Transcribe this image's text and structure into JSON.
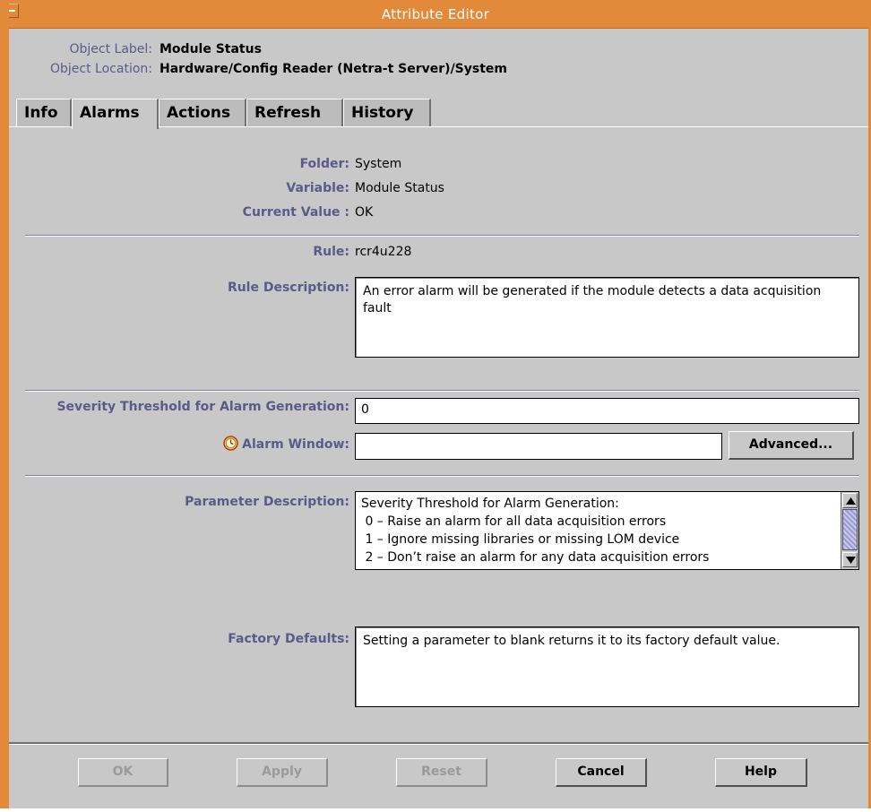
{
  "window": {
    "title": "Attribute Editor",
    "frame_color": "#e2893a"
  },
  "object": {
    "label_key": "Object Label:",
    "label_value": "Module Status",
    "location_key": "Object Location:",
    "location_value": "Hardware/Config Reader (Netra-t Server)/System"
  },
  "tabs": [
    {
      "label": "Info",
      "active": false
    },
    {
      "label": "Alarms",
      "active": true
    },
    {
      "label": "Actions",
      "active": false
    },
    {
      "label": "Refresh",
      "active": false
    },
    {
      "label": "History",
      "active": false
    }
  ],
  "alarms": {
    "folder_label": "Folder:",
    "folder_value": "System",
    "variable_label": "Variable:",
    "variable_value": "Module Status",
    "current_value_label": "Current Value :",
    "current_value": "OK",
    "rule_label": "Rule:",
    "rule_value": "rcr4u228",
    "rule_description_label": "Rule Description:",
    "rule_description": "An error alarm will be generated if the module detects a data acquisition fault",
    "severity_label": "Severity Threshold for Alarm Generation:",
    "severity_value": "0",
    "alarm_window_label": "Alarm Window:",
    "alarm_window_value": "",
    "alarm_window_icon": "clock-icon",
    "advanced_button": "Advanced...",
    "parameter_description_label": "Parameter Description:",
    "parameter_lines": [
      "Severity Threshold for Alarm Generation:",
      " 0 – Raise an alarm for all data acquisition errors",
      " 1 – Ignore missing libraries or missing LOM device",
      " 2 – Don’t raise an alarm for any data acquisition errors"
    ],
    "factory_defaults_label": "Factory Defaults:",
    "factory_defaults": "Setting a parameter to blank returns it to its factory default value."
  },
  "buttons": {
    "ok": "OK",
    "apply": "Apply",
    "reset": "Reset",
    "cancel": "Cancel",
    "help": "Help"
  }
}
